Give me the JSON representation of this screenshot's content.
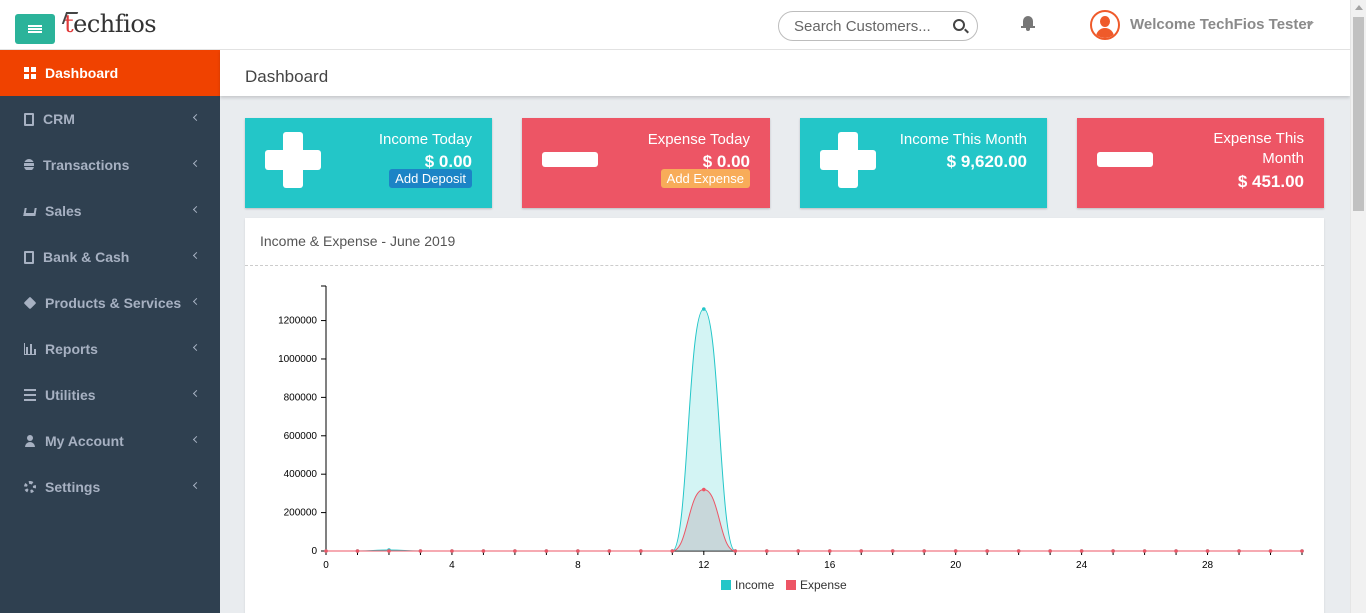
{
  "header": {
    "logo_prefix": "t",
    "logo_rest": "echfios",
    "search_placeholder": "Search Customers...",
    "welcome_text": "Welcome TechFios Tester"
  },
  "sidebar": {
    "items": [
      {
        "label": "Dashboard",
        "icon": "dashboard-icon",
        "active": true
      },
      {
        "label": "CRM",
        "icon": "crm-icon"
      },
      {
        "label": "Transactions",
        "icon": "database-icon"
      },
      {
        "label": "Sales",
        "icon": "cart-icon"
      },
      {
        "label": "Bank & Cash",
        "icon": "bank-icon"
      },
      {
        "label": "Products & Services",
        "icon": "cube-icon"
      },
      {
        "label": "Reports",
        "icon": "bar-chart-icon"
      },
      {
        "label": "Utilities",
        "icon": "list-icon"
      },
      {
        "label": "My Account",
        "icon": "user-icon"
      },
      {
        "label": "Settings",
        "icon": "gear-icon"
      }
    ]
  },
  "page": {
    "title": "Dashboard"
  },
  "cards": [
    {
      "title": "Income Today",
      "amount": "$ 0.00",
      "button": "Add Deposit",
      "color": "#23c6c8"
    },
    {
      "title": "Expense Today",
      "amount": "$ 0.00",
      "button": "Add Expense",
      "color": "#ed5565"
    },
    {
      "title": "Income This Month",
      "amount": "$ 9,620.00",
      "color": "#23c6c8"
    },
    {
      "title": "Expense This Month",
      "amount": "$ 451.00",
      "color": "#ed5565"
    }
  ],
  "chart_panel": {
    "title": "Income & Expense - June 2019"
  },
  "chart_data": {
    "type": "area",
    "title": "Income & Expense - June 2019",
    "x": [
      0,
      1,
      2,
      3,
      4,
      5,
      6,
      7,
      8,
      9,
      10,
      11,
      12,
      13,
      14,
      15,
      16,
      17,
      18,
      19,
      20,
      21,
      22,
      23,
      24,
      25,
      26,
      27,
      28,
      29,
      30,
      31
    ],
    "x_ticks": [
      0,
      4,
      8,
      12,
      16,
      20,
      24,
      28
    ],
    "y_ticks": [
      0,
      200000,
      400000,
      600000,
      800000,
      1000000,
      1200000
    ],
    "ylim": [
      0,
      1380000
    ],
    "xlim": [
      0,
      31
    ],
    "legend_position": "bottom",
    "series": [
      {
        "name": "Income",
        "color": "#23c6c8",
        "values": [
          0,
          0,
          5000,
          0,
          0,
          0,
          0,
          0,
          0,
          0,
          0,
          0,
          1260000,
          0,
          0,
          0,
          0,
          0,
          0,
          0,
          0,
          0,
          0,
          0,
          0,
          0,
          0,
          0,
          0,
          0,
          0,
          0
        ]
      },
      {
        "name": "Expense",
        "color": "#ed5565",
        "values": [
          0,
          0,
          0,
          0,
          0,
          0,
          0,
          0,
          0,
          0,
          0,
          0,
          320000,
          0,
          0,
          0,
          0,
          0,
          0,
          0,
          0,
          0,
          0,
          0,
          0,
          0,
          0,
          0,
          0,
          0,
          0,
          0
        ]
      }
    ]
  }
}
